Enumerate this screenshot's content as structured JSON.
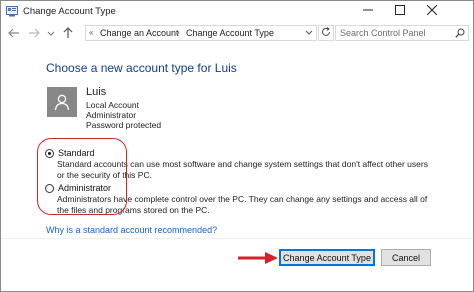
{
  "window": {
    "title": "Change Account Type"
  },
  "address": {
    "crumbs": [
      "Change an Account",
      "Change Account Type"
    ],
    "search_placeholder": "Search Control Panel"
  },
  "main": {
    "heading": "Choose a new account type for Luis",
    "user": {
      "name": "Luis",
      "lines": [
        "Local Account",
        "Administrator",
        "Password protected"
      ]
    },
    "options": [
      {
        "label": "Standard",
        "selected": true,
        "description": "Standard accounts can use most software and change system settings that don't affect other users or the security of this PC."
      },
      {
        "label": "Administrator",
        "selected": false,
        "description": "Administrators have complete control over the PC. They can change any settings and access all of the files and programs stored on the PC."
      }
    ],
    "help_link": "Why is a standard account recommended?"
  },
  "buttons": {
    "primary": "Change Account Type",
    "cancel": "Cancel"
  },
  "colors": {
    "heading": "#0f3c92",
    "link": "#1565c0",
    "highlight": "#d2232a",
    "primary_border": "#0078d7"
  },
  "icons": [
    "control-panel-icon",
    "minimize-icon",
    "maximize-icon",
    "close-icon",
    "back-arrow-icon",
    "forward-arrow-icon",
    "recent-dropdown-icon",
    "up-arrow-icon",
    "breadcrumb-root-icon",
    "address-dropdown-icon",
    "refresh-icon",
    "search-icon",
    "user-avatar-icon",
    "red-arrow-icon"
  ]
}
